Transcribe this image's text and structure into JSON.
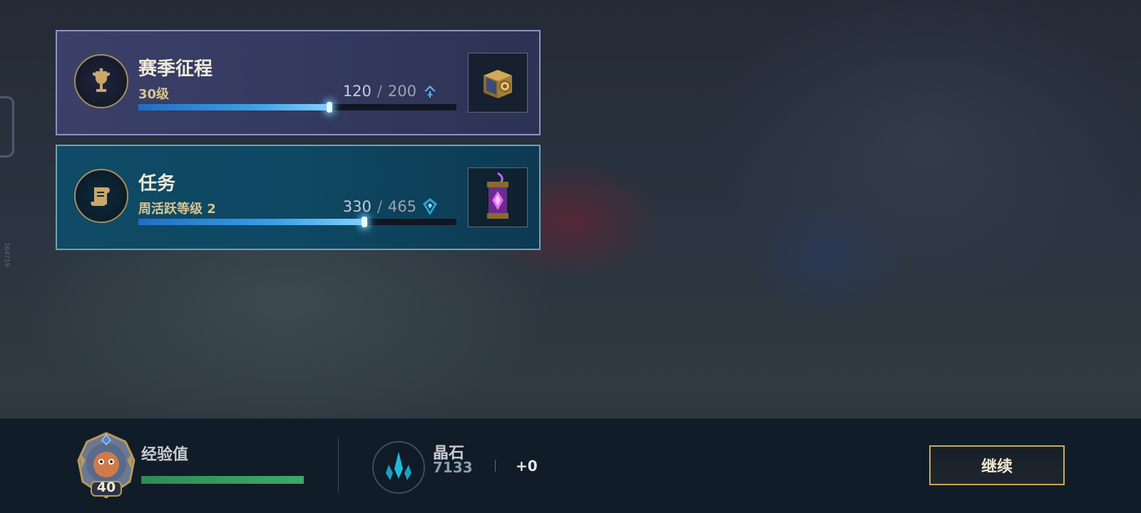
{
  "side_code": "164719",
  "season_card": {
    "title": "赛季征程",
    "subtitle": "30级",
    "progress_current": "120",
    "progress_separator": "/",
    "progress_max": "200",
    "progress_fraction": 0.6,
    "emblem_icon": "trophy-icon",
    "reward_icon": "treasure-chest-icon",
    "currency_icon": "double-chevron-up-icon"
  },
  "task_card": {
    "title": "任务",
    "subtitle": "周活跃等级 2",
    "progress_current": "330",
    "progress_separator": "/",
    "progress_max": "465",
    "progress_fraction": 0.71,
    "emblem_icon": "scroll-icon",
    "reward_icon": "purple-lantern-icon",
    "currency_icon": "blue-gem-icon"
  },
  "bottom_bar": {
    "avatar_level": "40",
    "exp_label": "经验值",
    "exp_fraction": 1.0,
    "crystal_label": "晶石",
    "crystal_value": "7133",
    "crystal_gain": "+0",
    "continue_label": "继续"
  },
  "colors": {
    "season_border": "#8c93c8",
    "task_border": "#6fa3b3",
    "progress_fill": "#3aa0e6",
    "exp_fill": "#3ca86a",
    "button_border": "#c9a85d"
  }
}
